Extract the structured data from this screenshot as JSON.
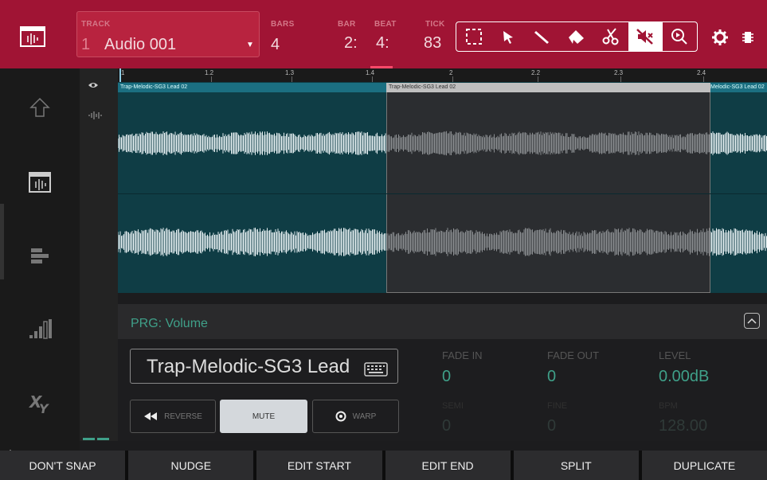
{
  "header": {
    "track_label": "TRACK",
    "track_number": "1",
    "track_name": "Audio 001",
    "bars_label": "BARS",
    "bars_value": "4",
    "bar_label": "BAR",
    "bar_value": "2:",
    "beat_label": "BEAT",
    "beat_value": "4:",
    "tick_label": "TICK",
    "tick_value": "83"
  },
  "tools": [
    {
      "name": "select-region-tool",
      "icon": "dashed-rect-icon"
    },
    {
      "name": "pointer-tool",
      "icon": "arrow-cursor-icon"
    },
    {
      "name": "pencil-tool",
      "icon": "pencil-icon"
    },
    {
      "name": "eraser-tool",
      "icon": "eraser-icon"
    },
    {
      "name": "scissors-tool",
      "icon": "scissors-icon"
    },
    {
      "name": "mute-tool",
      "icon": "speaker-muted-icon",
      "active": true
    },
    {
      "name": "zoom-tool",
      "icon": "zoom-icon"
    }
  ],
  "ruler": {
    "labels": [
      "1",
      "1.2",
      "1.3",
      "1.4",
      "2",
      "2.2",
      "2.3",
      "2.4"
    ]
  },
  "regions": {
    "left_name": "Trap-Melodic-SG3 Lead 02",
    "mid_name": "Trap-Melodic-SG3 Lead 02",
    "right_name": "Melodic-SG3 Lead 02"
  },
  "automation": {
    "label": "PRG: Volume"
  },
  "edit": {
    "sample_name": "Trap-Melodic-SG3 Lead",
    "reverse_label": "REVERSE",
    "mute_label": "MUTE",
    "warp_label": "WARP",
    "fade_in_label": "FADE IN",
    "fade_in_value": "0",
    "fade_out_label": "FADE OUT",
    "fade_out_value": "0",
    "level_label": "LEVEL",
    "level_value": "0.00dB",
    "semi_label": "SEMI",
    "semi_value": "0",
    "fine_label": "FINE",
    "fine_value": "0",
    "bpm_label": "BPM",
    "bpm_value": "128.00"
  },
  "function_buttons": [
    "DON'T SNAP",
    "NUDGE",
    "EDIT START",
    "EDIT END",
    "SPLIT",
    "DUPLICATE"
  ],
  "colors": {
    "header": "#a01434",
    "waveform_bg": "#0f3d45",
    "selection": "#2b2d30",
    "accent_green": "#3fa089"
  }
}
